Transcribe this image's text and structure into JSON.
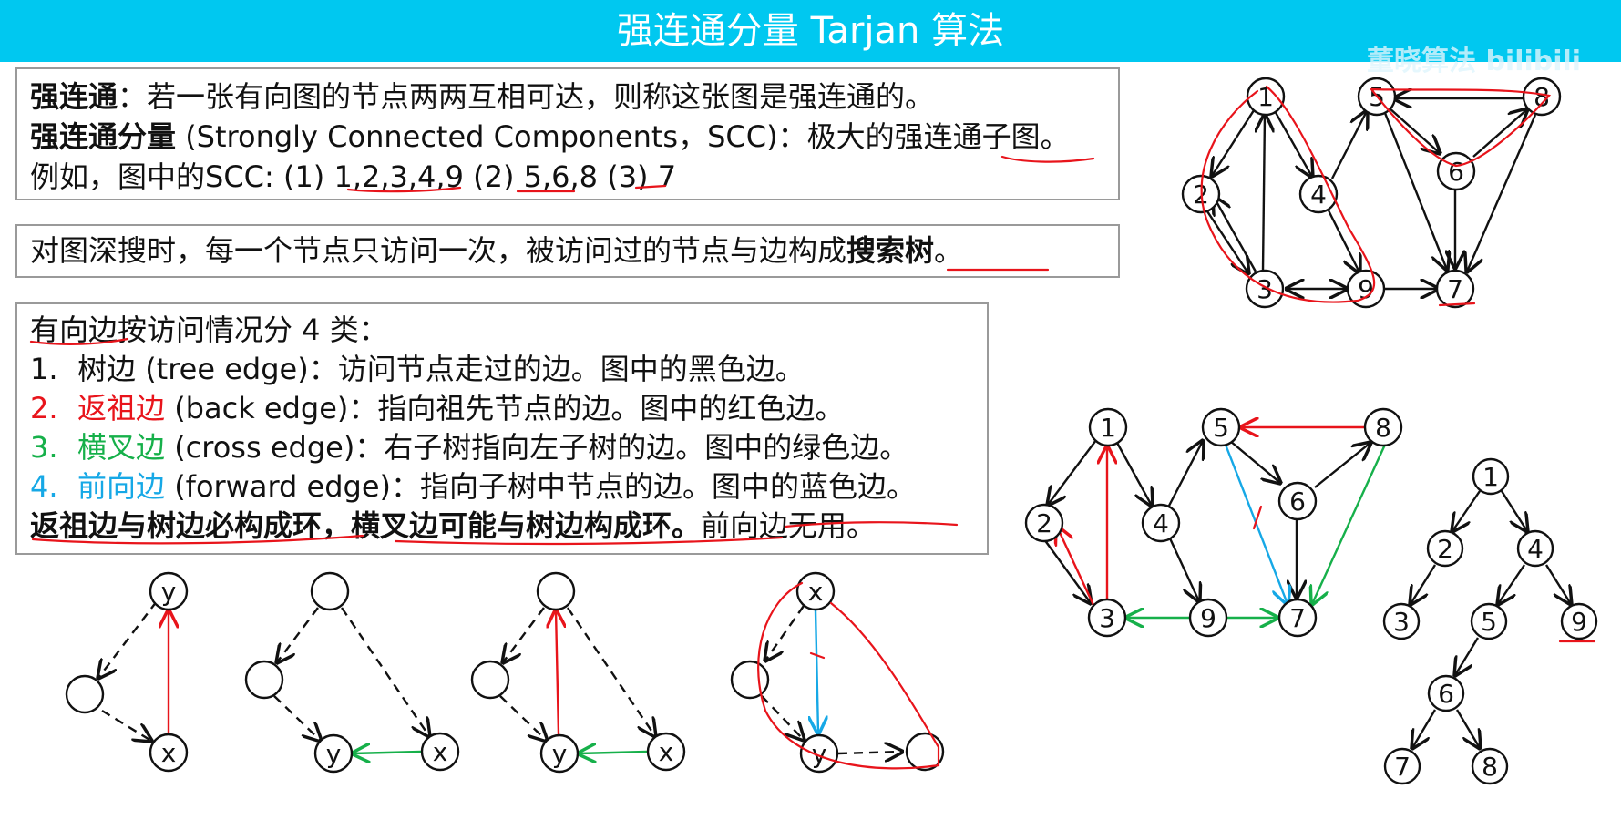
{
  "header": {
    "title": "强连通分量 Tarjan 算法",
    "watermark": "董晓算法 bilibili"
  },
  "definition": {
    "l1_term": "强连通",
    "l1_text": "：若一张有向图的节点两两互相可达，则称这张图是强连通的。",
    "l2_term": "强连通分量",
    "l2_text": " (Strongly Connected Components，SCC)：极大的强连通子图。",
    "l3_text": "例如，图中的SCC: (1) 1,2,3,4,9 (2) 5,6,8 (3) 7"
  },
  "search_tree": {
    "text_prefix": "对图深搜时，每一个节点只访问一次，被访问过的节点与边构成",
    "text_bold": "搜索树",
    "text_end": "。"
  },
  "edge_types": {
    "heading": "有向边按访问情况分 4 类：",
    "items": [
      {
        "num": "1.",
        "name": "树边",
        "desc": " (tree edge)：访问节点走过的边。图中的黑色边。",
        "color": "#111111"
      },
      {
        "num": "2.",
        "name": "返祖边",
        "desc": " (back edge)：指向祖先节点的边。图中的红色边。",
        "color": "#e8141b"
      },
      {
        "num": "3.",
        "name": "横叉边",
        "desc": " (cross edge)：右子树指向左子树的边。图中的绿色边。",
        "color": "#16b04a"
      },
      {
        "num": "4.",
        "name": "前向边",
        "desc": " (forward edge)：指向子树中节点的边。图中的蓝色边。",
        "color": "#16a8e6"
      }
    ],
    "summary_bold": "返祖边与树边必构成环，横叉边可能与树边构成环。",
    "summary_rest": "前向边无用。"
  },
  "colors": {
    "title_bar": "#00c8f0",
    "tree": "#111111",
    "back": "#e8141b",
    "cross": "#16b04a",
    "forward": "#16a8e6",
    "annotation": "#e8141b"
  },
  "diagrams": {
    "graph_top": {
      "nodes": [
        "1",
        "2",
        "3",
        "4",
        "5",
        "6",
        "7",
        "8",
        "9"
      ],
      "edges": [
        [
          "1",
          "2"
        ],
        [
          "2",
          "3"
        ],
        [
          "3",
          "1"
        ],
        [
          "3",
          "2"
        ],
        [
          "1",
          "4"
        ],
        [
          "4",
          "9"
        ],
        [
          "9",
          "3"
        ],
        [
          "3",
          "9"
        ],
        [
          "9",
          "7"
        ],
        [
          "4",
          "5"
        ],
        [
          "5",
          "6"
        ],
        [
          "6",
          "8"
        ],
        [
          "8",
          "5"
        ],
        [
          "6",
          "7"
        ],
        [
          "5",
          "7"
        ],
        [
          "8",
          "7"
        ]
      ]
    },
    "graph_mid": {
      "nodes": [
        "1",
        "2",
        "3",
        "4",
        "5",
        "6",
        "7",
        "8",
        "9"
      ],
      "edges": [
        {
          "from": "1",
          "to": "2",
          "type": "tree"
        },
        {
          "from": "2",
          "to": "3",
          "type": "tree"
        },
        {
          "from": "3",
          "to": "1",
          "type": "back"
        },
        {
          "from": "3",
          "to": "2",
          "type": "back"
        },
        {
          "from": "1",
          "to": "4",
          "type": "tree"
        },
        {
          "from": "4",
          "to": "5",
          "type": "tree"
        },
        {
          "from": "5",
          "to": "6",
          "type": "tree"
        },
        {
          "from": "6",
          "to": "8",
          "type": "tree"
        },
        {
          "from": "8",
          "to": "5",
          "type": "back"
        },
        {
          "from": "6",
          "to": "7",
          "type": "tree"
        },
        {
          "from": "5",
          "to": "7",
          "type": "forward"
        },
        {
          "from": "8",
          "to": "7",
          "type": "cross"
        },
        {
          "from": "4",
          "to": "9",
          "type": "tree"
        },
        {
          "from": "9",
          "to": "3",
          "type": "cross"
        },
        {
          "from": "9",
          "to": "7",
          "type": "cross"
        }
      ]
    },
    "search_tree": {
      "nodes": [
        "1",
        "2",
        "3",
        "4",
        "5",
        "6",
        "7",
        "8",
        "9"
      ],
      "edges": [
        [
          "1",
          "2"
        ],
        [
          "1",
          "4"
        ],
        [
          "2",
          "3"
        ],
        [
          "4",
          "5"
        ],
        [
          "4",
          "9"
        ],
        [
          "5",
          "6"
        ],
        [
          "6",
          "7"
        ],
        [
          "6",
          "8"
        ]
      ]
    },
    "patterns": [
      {
        "labels": [
          "y",
          "",
          "x"
        ],
        "solid_edge": "back"
      },
      {
        "labels": [
          "",
          "",
          "y",
          "x"
        ],
        "solid_edge": "cross"
      },
      {
        "labels": [
          "",
          "",
          "y",
          "x"
        ],
        "solid_edges": [
          "back",
          "cross"
        ]
      },
      {
        "labels": [
          "x",
          "",
          "y",
          ""
        ],
        "solid_edge": "forward"
      }
    ]
  }
}
